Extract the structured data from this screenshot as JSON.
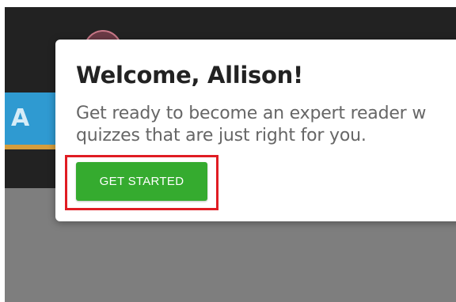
{
  "background": {
    "tile_letter": "A"
  },
  "dialog": {
    "title": "Welcome, Allison!",
    "message_line1": "Get ready to become an expert reader w",
    "message_line2": "quizzes that are just right for you.",
    "button_label": "GET STARTED"
  },
  "colors": {
    "button": "#35ab2f",
    "highlight": "#e01c23",
    "header": "#222222",
    "overlay": "#7e7e7e",
    "tile": "#2f9ad1"
  }
}
